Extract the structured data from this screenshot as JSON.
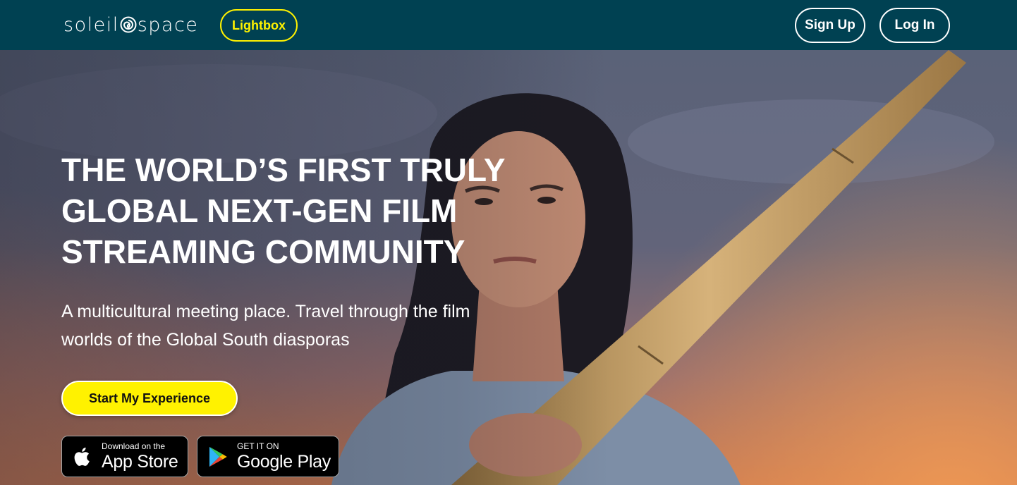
{
  "brand": {
    "name_left": "soleil",
    "name_right": "space",
    "logo_icon": "spiral-sun-icon"
  },
  "header": {
    "lightbox_label": "Lightbox",
    "signup_label": "Sign Up",
    "login_label": "Log In"
  },
  "hero": {
    "headline": "THE WORLD’S FIRST TRULY GLOBAL NEXT-GEN FILM STREAMING COMMUNITY",
    "subtitle": "A multicultural meeting place. Travel through the film worlds of the Global South diasporas",
    "cta_label": "Start My Experience"
  },
  "stores": {
    "appstore": {
      "small": "Download on the",
      "big": "App Store",
      "icon": "apple-icon"
    },
    "googleplay": {
      "small": "GET IT ON",
      "big": "Google Play",
      "icon": "google-play-icon"
    }
  },
  "colors": {
    "header_bg": "#004152",
    "accent_yellow": "#fff200",
    "white": "#ffffff"
  }
}
